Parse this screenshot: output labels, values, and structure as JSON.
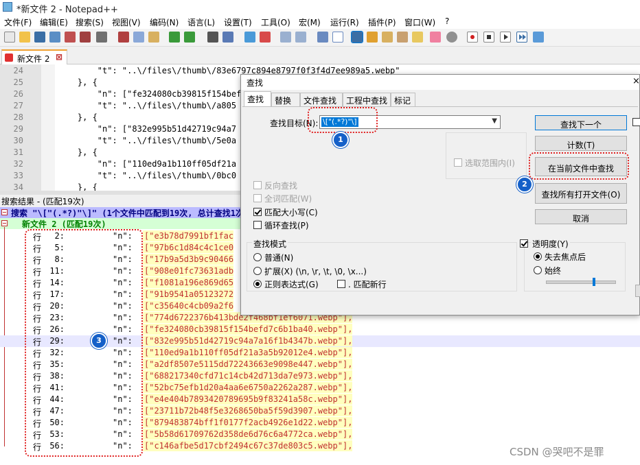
{
  "window": {
    "title": "*新文件 2 - Notepad++"
  },
  "menu": [
    "文件(F)",
    "编辑(E)",
    "搜索(S)",
    "视图(V)",
    "编码(N)",
    "语言(L)",
    "设置(T)",
    "工具(O)",
    "宏(M)",
    "运行(R)",
    "插件(P)",
    "窗口(W)",
    "?"
  ],
  "tabs": [
    {
      "label": "新文件 2"
    }
  ],
  "editor": {
    "lines": [
      {
        "num": "24",
        "text": "        \"t\": \"..\\/files\\/thumb\\/83e6797c894e8797f0f3f4d7ee989a5.webp\""
      },
      {
        "num": "25",
        "text": "    }, {"
      },
      {
        "num": "26",
        "text": "        \"n\": [\"fe324080cb39815f154bef"
      },
      {
        "num": "27",
        "text": "        \"t\": \"..\\/files\\/thumb\\/a805"
      },
      {
        "num": "28",
        "text": "    }, {"
      },
      {
        "num": "29",
        "text": "        \"n\": [\"832e995b51d42719c94a7"
      },
      {
        "num": "30",
        "text": "        \"t\": \"..\\/files\\/thumb\\/5e0a"
      },
      {
        "num": "31",
        "text": "    }, {"
      },
      {
        "num": "32",
        "text": "        \"n\": [\"110ed9a1b110ff05df21a"
      },
      {
        "num": "33",
        "text": "        \"t\": \"..\\/files\\/thumb\\/0bc0"
      },
      {
        "num": "34",
        "text": "    }, {"
      }
    ]
  },
  "results": {
    "panel_title": "搜索结果 - (匹配19次)",
    "header": "搜索 \"\\[\"(.*?)\"\\]\" (1个文件中匹配到19次, 总计查找1次)",
    "file_line": "新文件 2 (匹配19次)",
    "line_label": "行",
    "key": "\"n\":",
    "rows": [
      {
        "line": "2:",
        "value": "[\"e3b78d7991bf1fac"
      },
      {
        "line": "5:",
        "value": "[\"97b6c1d84c4c1ce0"
      },
      {
        "line": "8:",
        "value": "[\"17b9a5d3b9c90466"
      },
      {
        "line": "11:",
        "value": "[\"908e01fc73631adb"
      },
      {
        "line": "14:",
        "value": "[\"f1081a196e869d65"
      },
      {
        "line": "17:",
        "value": "[\"91b9541a05123272"
      },
      {
        "line": "20:",
        "value": "[\"c35640c4cb09a2f6"
      },
      {
        "line": "23:",
        "value": "[\"774d6722376b413bde2f468bf1ef6071.webp\"],"
      },
      {
        "line": "26:",
        "value": "[\"fe324080cb39815f154befd7c6b1ba40.webp\"],"
      },
      {
        "line": "29:",
        "value": "[\"832e995b51d42719c94a7a16f1b4347b.webp\"],"
      },
      {
        "line": "32:",
        "value": "[\"110ed9a1b110ff05df21a3a5b92012e4.webp\"],"
      },
      {
        "line": "35:",
        "value": "[\"a2df8507e5115dd72243663e9098e447.webp\"],"
      },
      {
        "line": "38:",
        "value": "[\"688217340cfd71c14cb42d713da7e973.webp\"],"
      },
      {
        "line": "41:",
        "value": "[\"52bc75efb1d20a4aa6e6750a2262a287.webp\"],"
      },
      {
        "line": "44:",
        "value": "[\"e4e404b7893420789695b9f83241a58c.webp\"],"
      },
      {
        "line": "47:",
        "value": "[\"23711b72b48f5e3268650ba5f59d3907.webp\"],"
      },
      {
        "line": "50:",
        "value": "[\"879483874bff1f0177f2acb4926e1d22.webp\"],"
      },
      {
        "line": "53:",
        "value": "[\"5b58d61709762d358de6d76c6a4772ca.webp\"],"
      },
      {
        "line": "56:",
        "value": "[\"c146afbe5d17cbf2494c67c37de803c5.webp\"],"
      }
    ]
  },
  "dialog": {
    "title": "查找",
    "close": "×",
    "tabs": [
      "查找",
      "替换",
      "文件查找",
      "工程中查找",
      "标记"
    ],
    "find_label": "查找目标(N):",
    "find_value": "\\[\"(.*?)\"\\]",
    "buttons": {
      "find_next": "查找下一个",
      "count": "计数(T)",
      "find_in_current": "在当前文件中查找",
      "find_in_all_open": "查找所有打开文件(O)",
      "cancel": "取消"
    },
    "in_selection": "选取范围内(I)",
    "backward": "反向查找",
    "whole_word": "全词匹配(W)",
    "match_case": "匹配大小写(C)",
    "wrap_around": "循环查找(P)",
    "search_mode": {
      "label": "查找模式",
      "normal": "普通(N)",
      "extended": "扩展(X) (\\n, \\r, \\t, \\0, \\x...)",
      "regex": "正则表达式(G)",
      "dot_newline": ". 匹配新行"
    },
    "transparency": {
      "label": "透明度(Y)",
      "on_lose_focus": "失去焦点后",
      "always": "始终",
      "level": 0.7
    }
  },
  "annotations": [
    "1",
    "2",
    "3"
  ],
  "watermark": "CSDN @哭吧不是罪",
  "colors": {
    "accent": "#0078d7",
    "annotation": "#e02020",
    "badge": "#1560c8",
    "result_value": "#c03030"
  }
}
